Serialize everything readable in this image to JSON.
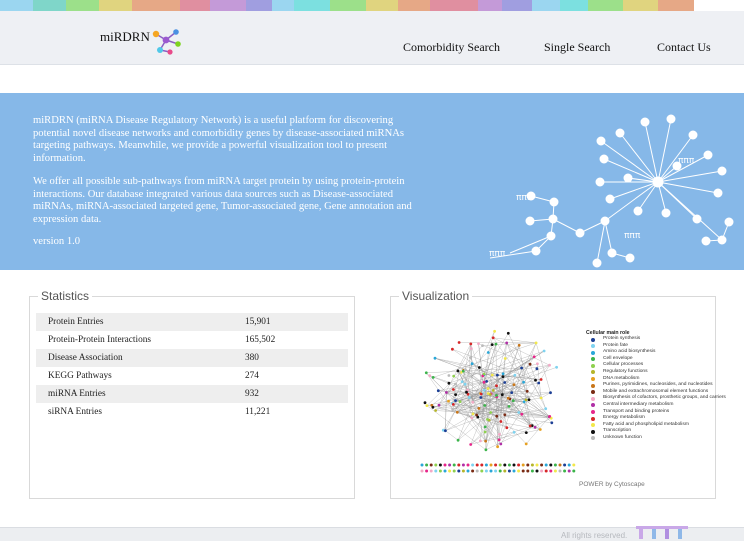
{
  "brand": "miRDRN",
  "nav": [
    "Comorbidity Search",
    "Single Search",
    "Contact Us"
  ],
  "intro": {
    "paragraph1": "miRDRN (miRNA Disease Regulatory Network) is a useful platform for discovering potential novel disease networks and comorbidity genes by disease-associated miRNAs targeting pathways. Meanwhile, we provide a powerful visualization tool to present information.",
    "paragraph2": "We offer all possible sub-pathways from miRNA target protein by using protein-protein interactions. Our database integrated various data sources such as Disease-associated miRNAs, miRNA-associated targeted gene, Tumor-associated gene, Gene annotation and expression data.",
    "version": "version 1.0"
  },
  "statistics": {
    "title": "Statistics",
    "rows": [
      {
        "label": "Protein Entries",
        "value": "15,901"
      },
      {
        "label": "Protein-Protein Interactions",
        "value": "165,502"
      },
      {
        "label": "Disease Association",
        "value": "380"
      },
      {
        "label": "KEGG Pathways",
        "value": "274"
      },
      {
        "label": "miRNA Entries",
        "value": "932"
      },
      {
        "label": "siRNA Entries",
        "value": "11,221"
      }
    ]
  },
  "visualization": {
    "title": "Visualization",
    "legend_title": "Cellular main role",
    "legend": [
      {
        "label": "Protein synthesis",
        "color": "#1c3f95"
      },
      {
        "label": "Protein fate",
        "color": "#7fd3f0"
      },
      {
        "label": "Amino acid biosynthesis",
        "color": "#2aa7d8"
      },
      {
        "label": "Cell envelope",
        "color": "#3cb44b"
      },
      {
        "label": "Cellular processes",
        "color": "#8fd14f"
      },
      {
        "label": "Regulatory functions",
        "color": "#b5b52a"
      },
      {
        "label": "DNA metabolism",
        "color": "#e6a020"
      },
      {
        "label": "Purines, pyrimidines, nucleosides, and nucleotides",
        "color": "#c8761a"
      },
      {
        "label": "Mobile and extrachromosomal element functions",
        "color": "#7a2b14"
      },
      {
        "label": "Biosynthesis of cofactors, prosthetic groups, and carriers",
        "color": "#f3a9c6"
      },
      {
        "label": "Central intermediary metabolism",
        "color": "#b02fa6"
      },
      {
        "label": "Transport and binding proteins",
        "color": "#e7268a"
      },
      {
        "label": "Energy metabolism",
        "color": "#d62728"
      },
      {
        "label": "Fatty acid and phospholipid metabolism",
        "color": "#f2e84b"
      },
      {
        "label": "Transcription",
        "color": "#111111"
      },
      {
        "label": "Unknown function",
        "color": "#bbbbbb"
      }
    ],
    "caption": "POWER by Cytoscape"
  },
  "footer": "All rights reserved.",
  "colors": {
    "hero_background": "#86b8e8",
    "topbar_background": "#eef0f4",
    "stripe": [
      "#9bd6f0",
      "#7fd6c9",
      "#9ce08a",
      "#e0d47f",
      "#e6a886",
      "#e08fa0",
      "#c49ad8",
      "#a09ee0",
      "#9bd6f0",
      "#7ce0e0",
      "#9ce08a",
      "#e0d47f",
      "#e6a886",
      "#e08fa0",
      "#c49ad8",
      "#a09ee0",
      "#9bd6f0",
      "#7ce0e0",
      "#9ce08a",
      "#e0d47f",
      "#e6a886"
    ]
  }
}
